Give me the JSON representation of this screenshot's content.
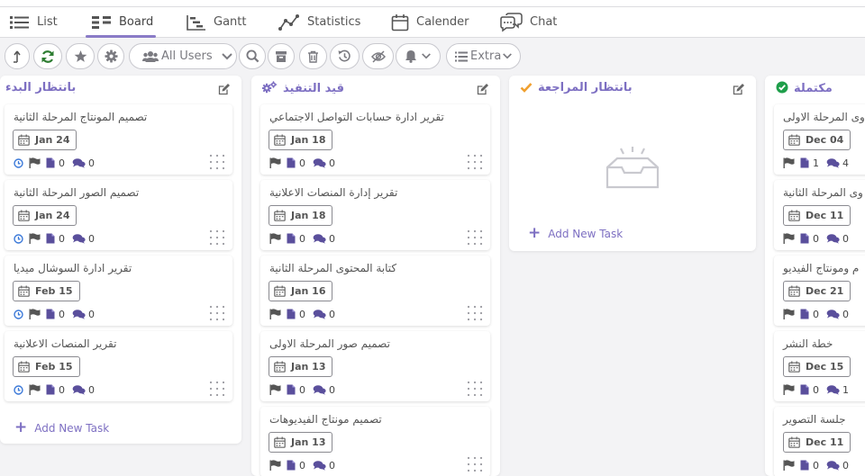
{
  "tabs": [
    {
      "label": "List"
    },
    {
      "label": "Board"
    },
    {
      "label": "Gantt"
    },
    {
      "label": "Statistics"
    },
    {
      "label": "Calender"
    },
    {
      "label": "Chat"
    }
  ],
  "toolbar": {
    "users_label": "All Users",
    "extra_label": "Extra"
  },
  "add_task_label": "Add New Task",
  "colors": {
    "accent": "#8a7bc7",
    "heading": "#7d6fc2",
    "refresh": "#2e7d32",
    "review_check": "#f0a030",
    "done_check": "#1e9e4a",
    "clock": "#3a78d8"
  },
  "columns": [
    {
      "title": "بانتظار البدء",
      "icon": "none",
      "cards": [
        {
          "title": "تصميم المونتاج المرحلة الثانية",
          "date": "Jan 24",
          "clock": true,
          "files": "0",
          "comments": "0"
        },
        {
          "title": "تصميم الصور المرحلة الثانية",
          "date": "Jan 24",
          "clock": true,
          "files": "0",
          "comments": "0"
        },
        {
          "title": "تقرير ادارة السوشال ميديا",
          "date": "Feb 15",
          "clock": true,
          "files": "0",
          "comments": "0"
        },
        {
          "title": "تقرير المنصات الاعلانية",
          "date": "Feb 15",
          "clock": true,
          "files": "0",
          "comments": "0"
        }
      ]
    },
    {
      "title": "قيد التنفيذ",
      "icon": "gears-icon",
      "cards": [
        {
          "title": "تقرير ادارة حسابات التواصل الاجتماعي",
          "date": "Jan 18",
          "clock": false,
          "files": "0",
          "comments": "0"
        },
        {
          "title": "تقرير إدارة المنصات الاعلانية",
          "date": "Jan 18",
          "clock": false,
          "files": "0",
          "comments": "0"
        },
        {
          "title": "كتابة المحتوى المرحلة الثانية",
          "date": "Jan 16",
          "clock": false,
          "files": "0",
          "comments": "0"
        },
        {
          "title": "تصميم صور المرحلة الاولى",
          "date": "Jan 13",
          "clock": false,
          "files": "0",
          "comments": "0"
        },
        {
          "title": "تصميم مونتاج الفيديوهات",
          "date": "Jan 13",
          "clock": false,
          "files": "0",
          "comments": "0"
        }
      ]
    },
    {
      "title": "بانتظار المراجعة",
      "icon": "check-icon",
      "cards": []
    },
    {
      "title": "مكتملة",
      "icon": "check-circle-icon",
      "cards": [
        {
          "title": "وى المرحلة الاولى",
          "date": "Dec 04",
          "clock": false,
          "files": "1",
          "comments": "4"
        },
        {
          "title": "وى المرحلة الثانية",
          "date": "Dec 11",
          "clock": false,
          "files": "0",
          "comments": "0"
        },
        {
          "title": "م ومونتاج الفيديو",
          "date": "Dec 21",
          "clock": false,
          "files": "0",
          "comments": "0"
        },
        {
          "title": "خطة النشر",
          "date": "Dec 15",
          "clock": false,
          "files": "0",
          "comments": "1"
        },
        {
          "title": "جلسة التصوير",
          "date": "Dec 11",
          "clock": false,
          "files": "0",
          "comments": "0"
        }
      ]
    }
  ]
}
